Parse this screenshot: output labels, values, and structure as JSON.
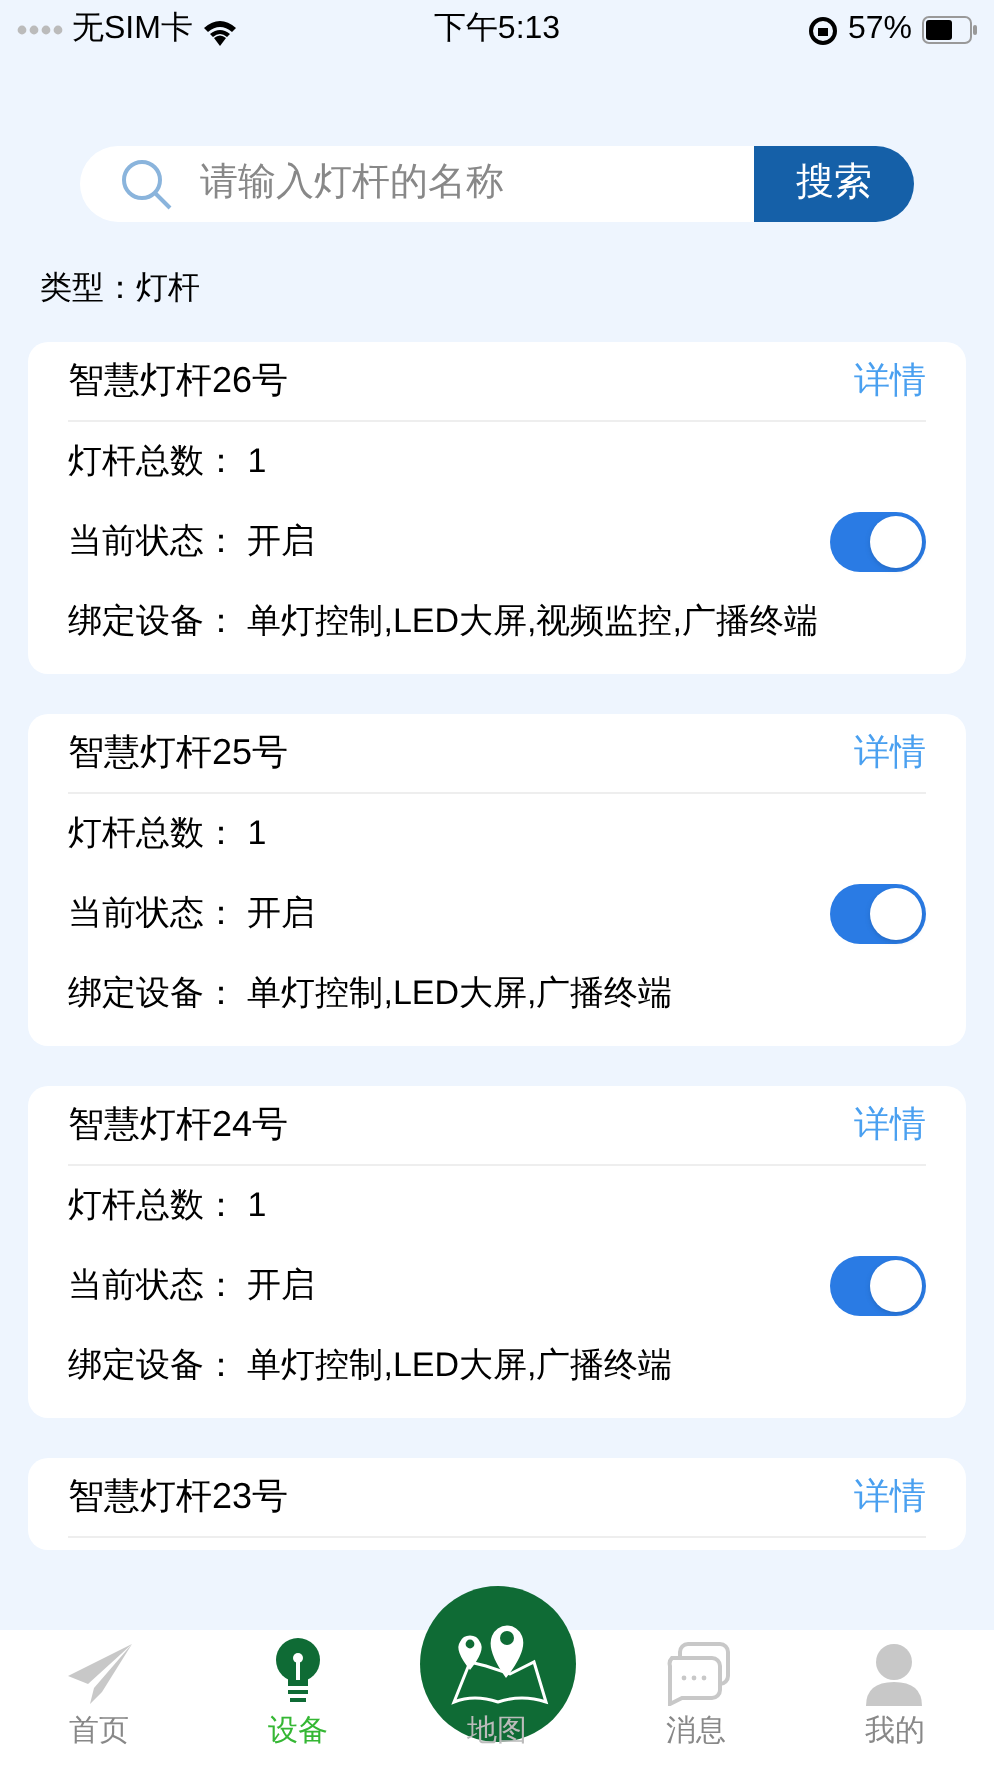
{
  "status_bar": {
    "carrier": "无SIM卡",
    "time": "下午5:13",
    "battery": "57%"
  },
  "search": {
    "placeholder": "请输入灯杆的名称",
    "button": "搜索"
  },
  "filter": {
    "label": "类型：",
    "value": "灯杆"
  },
  "cards": [
    {
      "title": "智慧灯杆26号",
      "link": "详情",
      "rows": [
        {
          "kind": "text",
          "label": "灯杆总数：",
          "value": "1"
        },
        {
          "kind": "switch",
          "label": "当前状态：",
          "value": "开启",
          "on": true
        },
        {
          "kind": "text",
          "label": "绑定设备：",
          "value": "单灯控制,LED大屏,视频监控,广播终端"
        }
      ]
    },
    {
      "title": "智慧灯杆25号",
      "link": "详情",
      "rows": [
        {
          "kind": "text",
          "label": "灯杆总数：",
          "value": "1"
        },
        {
          "kind": "switch",
          "label": "当前状态：",
          "value": "开启",
          "on": true
        },
        {
          "kind": "text",
          "label": "绑定设备：",
          "value": "单灯控制,LED大屏,广播终端"
        }
      ]
    },
    {
      "title": "智慧灯杆24号",
      "link": "详情",
      "rows": [
        {
          "kind": "text",
          "label": "灯杆总数：",
          "value": "1"
        },
        {
          "kind": "switch",
          "label": "当前状态：",
          "value": "开启",
          "on": true
        },
        {
          "kind": "text",
          "label": "绑定设备：",
          "value": "单灯控制,LED大屏,广播终端"
        }
      ]
    },
    {
      "title": "智慧灯杆23号",
      "link": "详情"
    }
  ],
  "tabs": [
    {
      "kind": "home",
      "label": "首页",
      "selected": false
    },
    {
      "kind": "device",
      "label": "设备",
      "selected": true
    },
    {
      "kind": "map",
      "label": "地图",
      "selected": false
    },
    {
      "kind": "message",
      "label": "消息",
      "selected": false
    },
    {
      "kind": "mine",
      "label": "我的",
      "selected": false
    }
  ]
}
